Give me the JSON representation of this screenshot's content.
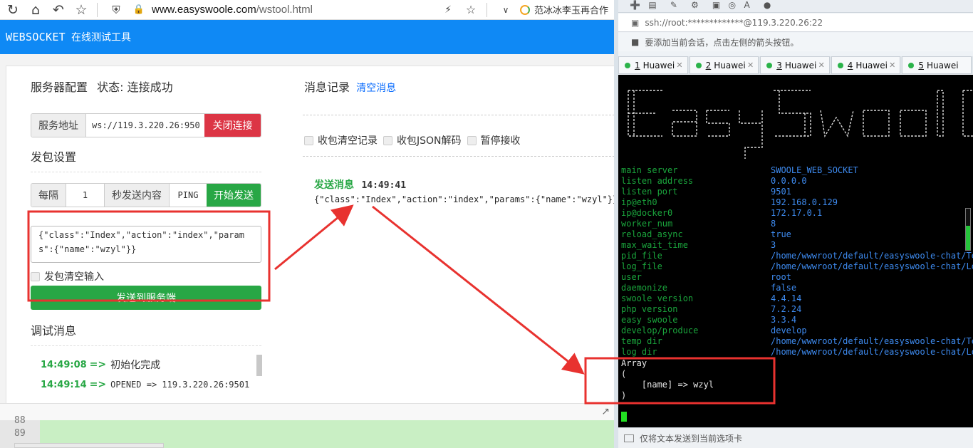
{
  "browser": {
    "url_host": "www.easyswoole.com",
    "url_path": "/wstool.html",
    "search_hint": "范冰冰李玉再合作"
  },
  "header": {
    "brand": "WEBSOCKET",
    "subtitle": "在线测试工具"
  },
  "server_config": {
    "title": "服务器配置",
    "status_label": "状态:",
    "status_value": "连接成功",
    "addr_label": "服务地址",
    "addr_value": "ws://119.3.220.26:950",
    "close_button": "关闭连接"
  },
  "packet": {
    "title": "发包设置",
    "every_label": "每隔",
    "interval": "1",
    "send_content_label": "秒发送内容",
    "ping_value": "PING",
    "start_button": "开始发送",
    "payload": "{\"class\":\"Index\",\"action\":\"index\",\"params\":{\"name\":\"wzyl\"}}",
    "clear_input_label": "发包清空输入",
    "send_button": "发送到服务端"
  },
  "debug": {
    "title": "调试消息",
    "items": [
      {
        "time": "14:49:08",
        "arrow": "=>",
        "text": "初始化完成"
      },
      {
        "time": "14:49:14",
        "arrow": "=>",
        "text": "OPENED => 119.3.220.26:9501"
      }
    ]
  },
  "messages": {
    "title": "消息记录",
    "clear_link": "清空消息",
    "options": [
      "收包清空记录",
      "收包JSON解码",
      "暂停接收"
    ],
    "entry_label": "发送消息",
    "entry_time": "14:49:41",
    "entry_body": "{\"class\":\"Index\",\"action\":\"index\",\"params\":{\"name\":\"wzyl\"}}"
  },
  "editor": {
    "line_numbers": [
      "88",
      "89"
    ]
  },
  "terminal": {
    "address": "ssh://root:*************@119.3.220.26:22",
    "hint": "要添加当前会话，点击左侧的箭头按钮。",
    "tabs": [
      {
        "num": "1",
        "name": "Huawei"
      },
      {
        "num": "2",
        "name": "Huawei"
      },
      {
        "num": "3",
        "name": "Huawei"
      },
      {
        "num": "4",
        "name": "Huawei"
      },
      {
        "num": "5",
        "name": "Huawei"
      }
    ],
    "rows": [
      {
        "key": "main server",
        "value": "SWOOLE_WEB_SOCKET"
      },
      {
        "key": "listen address",
        "value": "0.0.0.0"
      },
      {
        "key": "listen port",
        "value": "9501"
      },
      {
        "key": "ip@eth0",
        "value": "192.168.0.129"
      },
      {
        "key": "ip@docker0",
        "value": "172.17.0.1"
      },
      {
        "key": "worker_num",
        "value": "8"
      },
      {
        "key": "reload_async",
        "value": "true"
      },
      {
        "key": "max_wait_time",
        "value": "3"
      },
      {
        "key": "pid_file",
        "value": "/home/wwwroot/default/easyswoole-chat/Tem"
      },
      {
        "key": "log_file",
        "value": "/home/wwwroot/default/easyswoole-chat/Log"
      },
      {
        "key": "user",
        "value": "root"
      },
      {
        "key": "daemonize",
        "value": "false"
      },
      {
        "key": "swoole version",
        "value": "4.4.14"
      },
      {
        "key": "php version",
        "value": "7.2.24"
      },
      {
        "key": "easy swoole",
        "value": "3.3.4"
      },
      {
        "key": "develop/produce",
        "value": "develop"
      },
      {
        "key": "temp dir",
        "value": "/home/wwwroot/default/easyswoole-chat/Tem"
      },
      {
        "key": "log dir",
        "value": "/home/wwwroot/default/easyswoole-chat/Log"
      }
    ],
    "array_output": "Array\n(\n    [name] => wzyl\n)",
    "footer": "仅将文本发送到当前选项卡"
  },
  "colors": {
    "header_blue": "#0f89f5",
    "success_green": "#28a745",
    "danger_red": "#dc3545",
    "annotation_red": "#e8322f",
    "terminal_key_green": "#1aa43c",
    "terminal_value_blue": "#3e8bf0"
  }
}
